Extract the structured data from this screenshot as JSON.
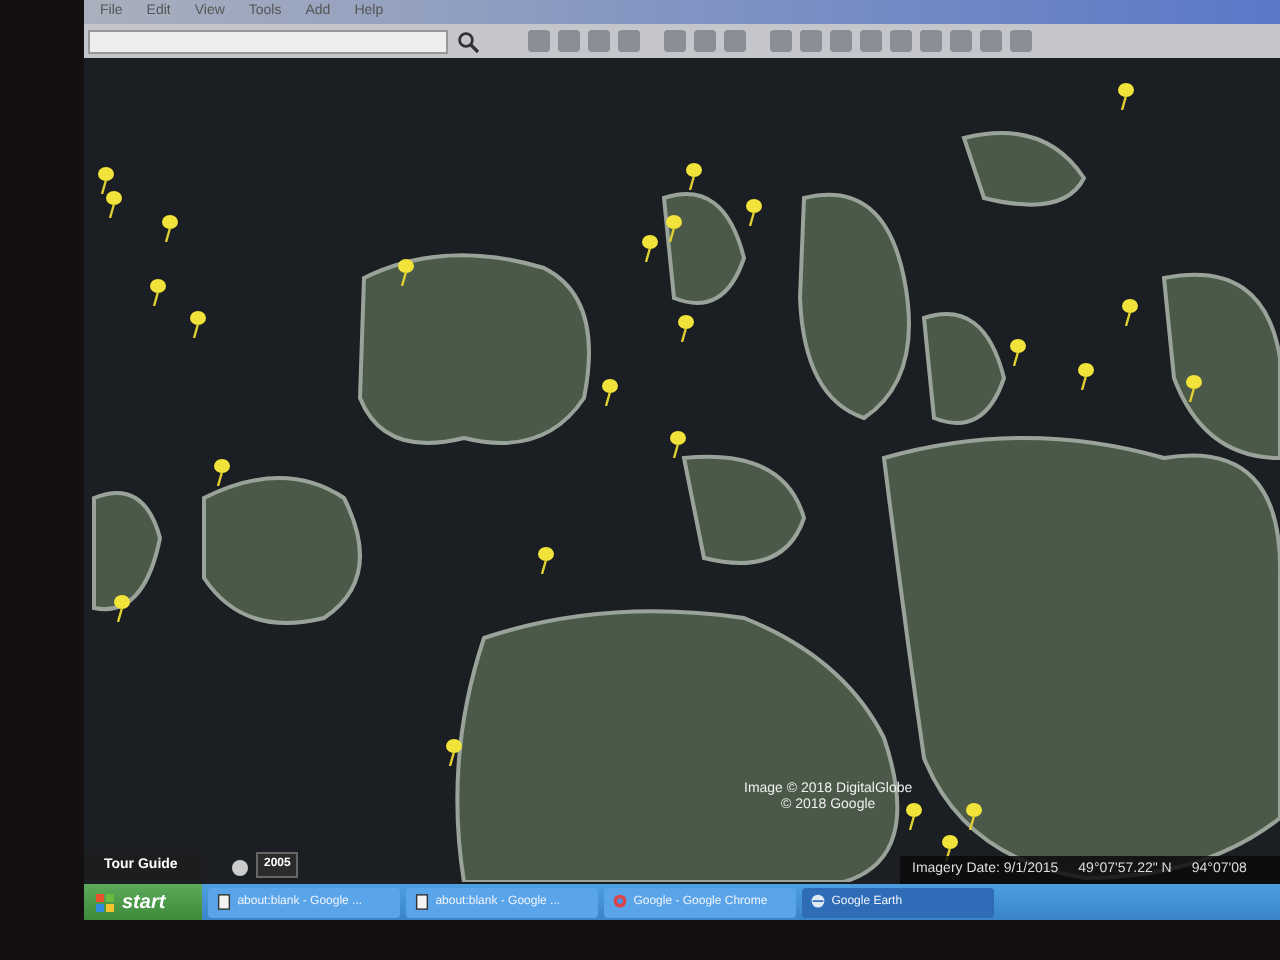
{
  "menu": [
    "File",
    "Edit",
    "View",
    "Tools",
    "Add",
    "Help"
  ],
  "tour_guide": {
    "label": "Tour Guide"
  },
  "historical_imagery": {
    "year": "2005"
  },
  "map": {
    "attribution": [
      "Image © 2018 DigitalGlobe",
      "© 2018 Google"
    ],
    "imagery_date": "Imagery Date: 9/1/2015",
    "latitude": "49°07'57.22\" N",
    "longitude": "94°07'08"
  },
  "taskbar": {
    "start": "start",
    "items": [
      {
        "label": "about:blank - Google ...",
        "kind": "page",
        "selected": false
      },
      {
        "label": "about:blank - Google ...",
        "kind": "page",
        "selected": false
      },
      {
        "label": "Google - Google Chrome",
        "kind": "chrome",
        "selected": false
      },
      {
        "label": "Google Earth",
        "kind": "earth",
        "selected": true
      }
    ]
  }
}
